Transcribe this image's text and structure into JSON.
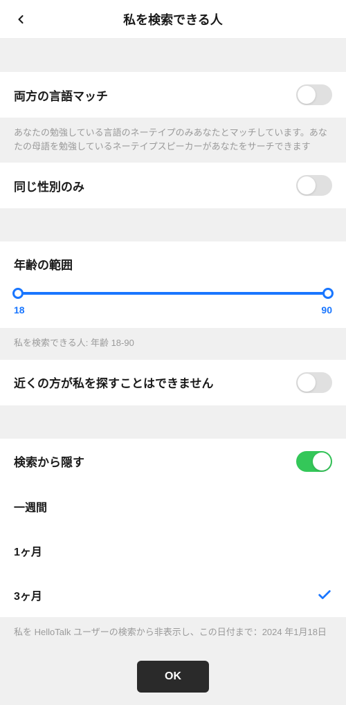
{
  "header": {
    "title": "私を検索できる人"
  },
  "languageMatch": {
    "label": "両方の言語マッチ",
    "helper": "あなたの勉強している言語のネーテイプのみあなたとマッチしています。あなたの母語を勉強しているネーテイプスピーカーがあなたをサーチできます",
    "enabled": false
  },
  "sameGender": {
    "label": "同じ性別のみ",
    "enabled": false
  },
  "ageRange": {
    "label": "年齢の範囲",
    "min": "18",
    "max": "90",
    "helper": "私を検索できる人: 年齢 18-90"
  },
  "hideNearby": {
    "label": "近くの方が私を探すことはできません",
    "enabled": false
  },
  "hideFromSearch": {
    "label": "検索から隠す",
    "enabled": true,
    "options": [
      {
        "label": "一週間",
        "selected": false
      },
      {
        "label": "1ヶ月",
        "selected": false
      },
      {
        "label": "3ヶ月",
        "selected": true
      }
    ],
    "helper": "私を HelloTalk ユーザーの検索から非表示し、この日付まで：2024 年1月18日"
  },
  "okButton": "OK"
}
